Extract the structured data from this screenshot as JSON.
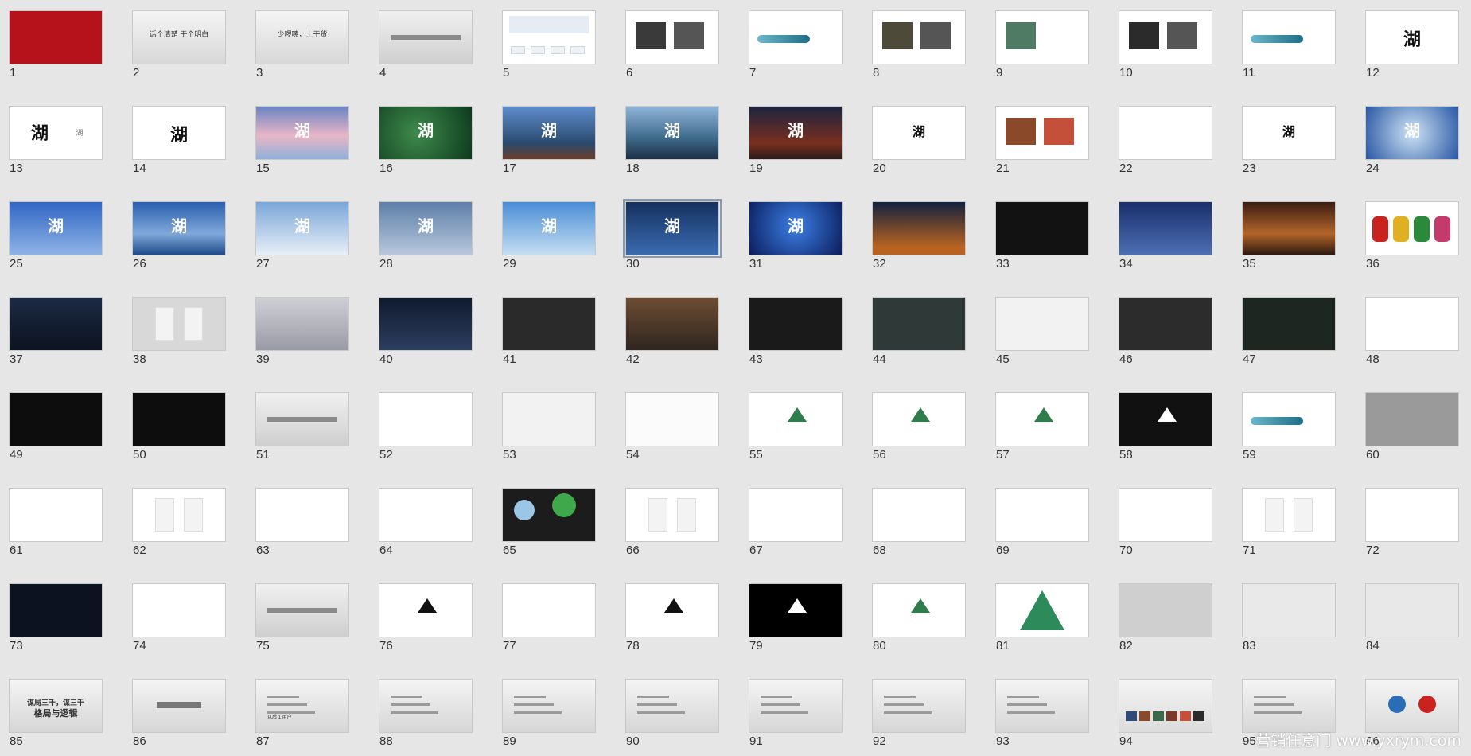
{
  "app": "slide-sorter-view",
  "watermark": "营销任意门 www.yxrym.com",
  "selected_slide": 30,
  "slides": [
    {
      "n": "1",
      "kind": "red"
    },
    {
      "n": "2",
      "kind": "text",
      "title": "话个清楚  干个明白"
    },
    {
      "n": "3",
      "kind": "text",
      "title": "少啰嗦，上干货"
    },
    {
      "n": "4",
      "kind": "bar"
    },
    {
      "n": "5",
      "kind": "form"
    },
    {
      "n": "6",
      "kind": "photos-dark"
    },
    {
      "n": "7",
      "kind": "brush-wave"
    },
    {
      "n": "8",
      "kind": "photo-boat"
    },
    {
      "n": "9",
      "kind": "photo-hills"
    },
    {
      "n": "10",
      "kind": "photo-figure"
    },
    {
      "n": "11",
      "kind": "brush-small"
    },
    {
      "n": "12",
      "kind": "logo-gray"
    },
    {
      "n": "13",
      "kind": "logo-white-hu",
      "title": "湖"
    },
    {
      "n": "14",
      "kind": "logo-white"
    },
    {
      "n": "15",
      "kind": "sky-pink"
    },
    {
      "n": "16",
      "kind": "leaf-green"
    },
    {
      "n": "17",
      "kind": "mountain-blue"
    },
    {
      "n": "18",
      "kind": "lake-blue"
    },
    {
      "n": "19",
      "kind": "night-red"
    },
    {
      "n": "20",
      "kind": "logo-small"
    },
    {
      "n": "21",
      "kind": "food"
    },
    {
      "n": "22",
      "kind": "blank"
    },
    {
      "n": "23",
      "kind": "logo-small"
    },
    {
      "n": "24",
      "kind": "sail-blue"
    },
    {
      "n": "25",
      "kind": "balloon"
    },
    {
      "n": "26",
      "kind": "yacht"
    },
    {
      "n": "27",
      "kind": "bus"
    },
    {
      "n": "28",
      "kind": "plane"
    },
    {
      "n": "29",
      "kind": "sail-sky"
    },
    {
      "n": "30",
      "kind": "flag"
    },
    {
      "n": "31",
      "kind": "stage"
    },
    {
      "n": "32",
      "kind": "dome-night"
    },
    {
      "n": "33",
      "kind": "truck"
    },
    {
      "n": "34",
      "kind": "kite"
    },
    {
      "n": "35",
      "kind": "bridge"
    },
    {
      "n": "36",
      "kind": "bags"
    },
    {
      "n": "37",
      "kind": "bottles-dark"
    },
    {
      "n": "38",
      "kind": "totes"
    },
    {
      "n": "39",
      "kind": "monitor"
    },
    {
      "n": "40",
      "kind": "billboard"
    },
    {
      "n": "41",
      "kind": "posters"
    },
    {
      "n": "42",
      "kind": "street"
    },
    {
      "n": "43",
      "kind": "book-hand"
    },
    {
      "n": "44",
      "kind": "book-dark"
    },
    {
      "n": "45",
      "kind": "book-open"
    },
    {
      "n": "46",
      "kind": "book-pink"
    },
    {
      "n": "47",
      "kind": "dark-forest"
    },
    {
      "n": "48",
      "kind": "photo-grid"
    },
    {
      "n": "49",
      "kind": "night-house"
    },
    {
      "n": "50",
      "kind": "night-lights"
    },
    {
      "n": "51",
      "kind": "bar"
    },
    {
      "n": "52",
      "kind": "circles"
    },
    {
      "n": "53",
      "kind": "hand-draw"
    },
    {
      "n": "54",
      "kind": "sketch"
    },
    {
      "n": "55",
      "kind": "mountain-logo"
    },
    {
      "n": "56",
      "kind": "logo-cards"
    },
    {
      "n": "57",
      "kind": "mountain-logo-green"
    },
    {
      "n": "58",
      "kind": "black-logo"
    },
    {
      "n": "59",
      "kind": "wave-line"
    },
    {
      "n": "60",
      "kind": "stationery"
    },
    {
      "n": "61",
      "kind": "bag-white"
    },
    {
      "n": "62",
      "kind": "cups"
    },
    {
      "n": "63",
      "kind": "banner"
    },
    {
      "n": "64",
      "kind": "stationery2"
    },
    {
      "n": "65",
      "kind": "badges"
    },
    {
      "n": "66",
      "kind": "water-bottles"
    },
    {
      "n": "67",
      "kind": "umbrella"
    },
    {
      "n": "68",
      "kind": "cd"
    },
    {
      "n": "69",
      "kind": "flag-blue"
    },
    {
      "n": "70",
      "kind": "sign-arrow"
    },
    {
      "n": "71",
      "kind": "tshirts"
    },
    {
      "n": "72",
      "kind": "room"
    },
    {
      "n": "73",
      "kind": "night-cube"
    },
    {
      "n": "74",
      "kind": "bus-stop"
    },
    {
      "n": "75",
      "kind": "bar"
    },
    {
      "n": "76",
      "kind": "ink-mountain"
    },
    {
      "n": "77",
      "kind": "calligraphy"
    },
    {
      "n": "78",
      "kind": "ink-mountain2"
    },
    {
      "n": "79",
      "kind": "black-mountain"
    },
    {
      "n": "80",
      "kind": "mountain-color"
    },
    {
      "n": "81",
      "kind": "mountain-big"
    },
    {
      "n": "82",
      "kind": "cards-gray"
    },
    {
      "n": "83",
      "kind": "box"
    },
    {
      "n": "84",
      "kind": "building"
    },
    {
      "n": "85",
      "kind": "text-big",
      "title": "谋局三千，谋三千",
      "title2": "格局与逻辑"
    },
    {
      "n": "86",
      "kind": "text-arrow"
    },
    {
      "n": "87",
      "kind": "text-lines",
      "title": "以后 1 用户"
    },
    {
      "n": "88",
      "kind": "text-lines"
    },
    {
      "n": "89",
      "kind": "text-lines"
    },
    {
      "n": "90",
      "kind": "text-lines"
    },
    {
      "n": "91",
      "kind": "text-lines"
    },
    {
      "n": "92",
      "kind": "text-lines"
    },
    {
      "n": "93",
      "kind": "text-lines"
    },
    {
      "n": "94",
      "kind": "photo-strip"
    },
    {
      "n": "95",
      "kind": "text-lines"
    },
    {
      "n": "96",
      "kind": "globes"
    }
  ]
}
